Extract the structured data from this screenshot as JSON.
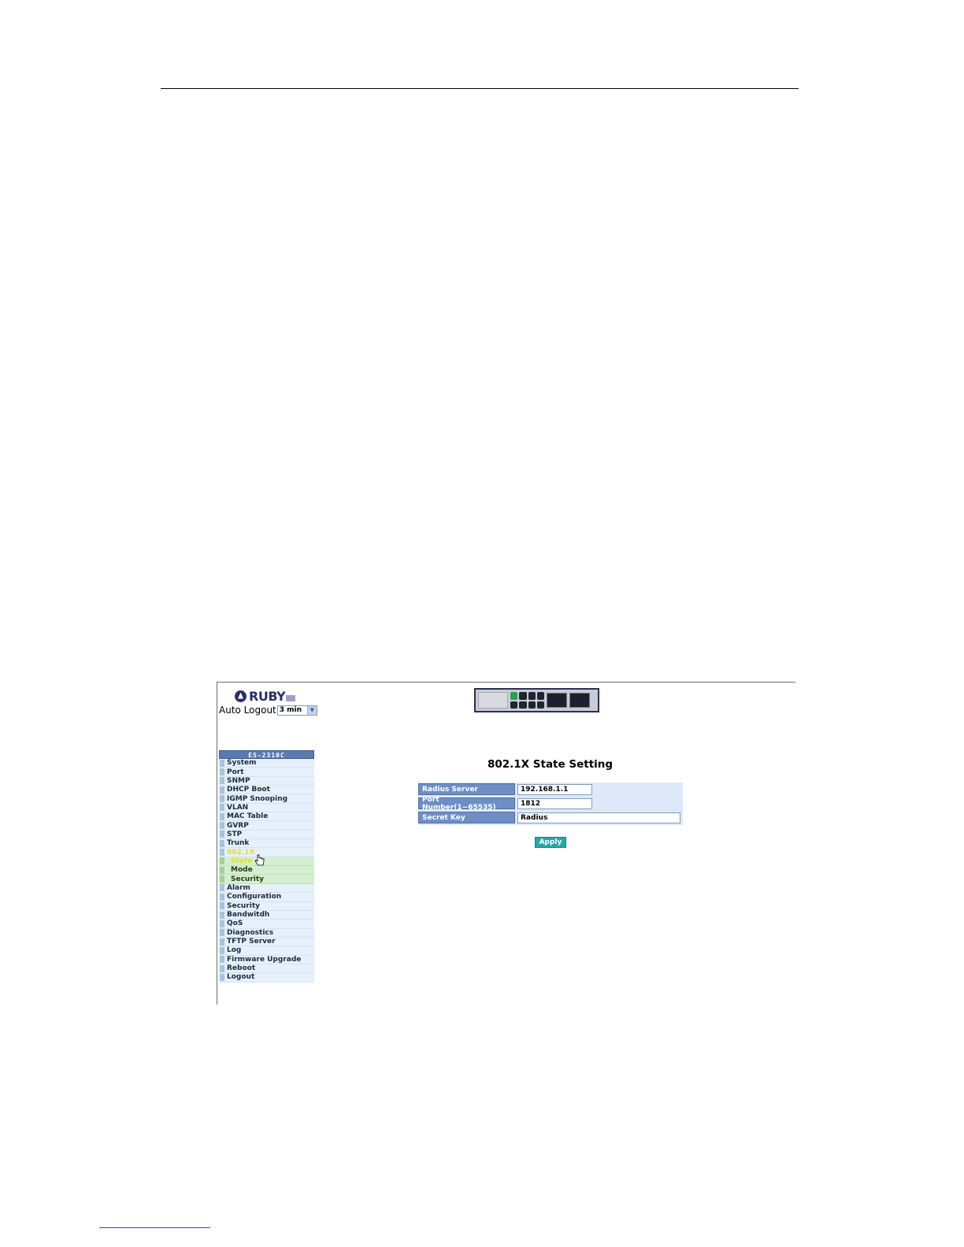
{
  "logo": {
    "text": "RUBY"
  },
  "auto_logout": {
    "label": "Auto Logout",
    "value": "3 min"
  },
  "sidebar": {
    "header": "ES-2310C",
    "items": [
      {
        "label": "System",
        "active": false,
        "sub": false
      },
      {
        "label": "Port",
        "active": false,
        "sub": false
      },
      {
        "label": "SNMP",
        "active": false,
        "sub": false
      },
      {
        "label": "DHCP Boot",
        "active": false,
        "sub": false
      },
      {
        "label": "IGMP Snooping",
        "active": false,
        "sub": false
      },
      {
        "label": "VLAN",
        "active": false,
        "sub": false
      },
      {
        "label": "MAC Table",
        "active": false,
        "sub": false
      },
      {
        "label": "GVRP",
        "active": false,
        "sub": false
      },
      {
        "label": "STP",
        "active": false,
        "sub": false
      },
      {
        "label": "Trunk",
        "active": false,
        "sub": false
      },
      {
        "label": "802.1X",
        "active": true,
        "sub": false
      },
      {
        "label": "State",
        "active": true,
        "sub": true
      },
      {
        "label": "Mode",
        "active": false,
        "sub": true
      },
      {
        "label": "Security",
        "active": false,
        "sub": true
      },
      {
        "label": "Alarm",
        "active": false,
        "sub": false
      },
      {
        "label": "Configuration",
        "active": false,
        "sub": false
      },
      {
        "label": "Security",
        "active": false,
        "sub": false
      },
      {
        "label": "Bandwitdh",
        "active": false,
        "sub": false
      },
      {
        "label": "QoS",
        "active": false,
        "sub": false
      },
      {
        "label": "Diagnostics",
        "active": false,
        "sub": false
      },
      {
        "label": "TFTP Server",
        "active": false,
        "sub": false
      },
      {
        "label": "Log",
        "active": false,
        "sub": false
      },
      {
        "label": "Firmware Upgrade",
        "active": false,
        "sub": false
      },
      {
        "label": "Reboot",
        "active": false,
        "sub": false
      },
      {
        "label": "Logout",
        "active": false,
        "sub": false
      }
    ]
  },
  "main": {
    "title": "802.1X State Setting",
    "fields": [
      {
        "label": "Radius Server",
        "value": "192.168.1.1",
        "width": "short"
      },
      {
        "label": "Port Number(1~65535)",
        "value": "1812",
        "width": "short"
      },
      {
        "label": "Secret Key",
        "value": "Radius",
        "width": "long"
      }
    ],
    "apply_label": "Apply"
  },
  "icons": {
    "cursor": "hand-pointer-icon",
    "dropdown": "chevron-down-icon",
    "logo": "ruby-logo-icon"
  }
}
